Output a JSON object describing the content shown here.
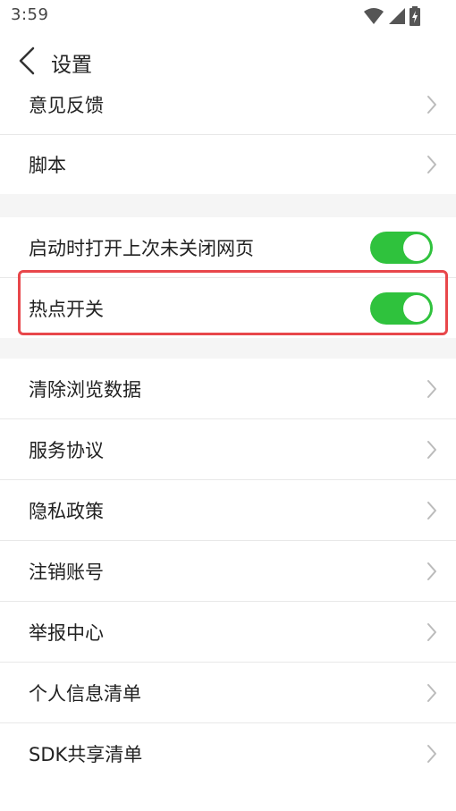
{
  "status_bar": {
    "time": "3:59",
    "icons": [
      "wifi-icon",
      "cellular-signal-icon",
      "battery-charging-icon"
    ]
  },
  "header": {
    "back_icon": "chevron-left-icon",
    "title": "设置"
  },
  "settings": {
    "group1": [
      {
        "label": "意见反馈"
      },
      {
        "label": "脚本"
      }
    ],
    "group2": [
      {
        "label": "启动时打开上次未关闭网页",
        "toggle": true
      },
      {
        "label": "热点开关",
        "toggle": true
      }
    ],
    "group3": [
      {
        "label": "清除浏览数据"
      },
      {
        "label": "服务协议"
      },
      {
        "label": "隐私政策"
      },
      {
        "label": "注销账号"
      },
      {
        "label": "举报中心"
      },
      {
        "label": "个人信息清单"
      },
      {
        "label": "SDK共享清单"
      }
    ]
  },
  "colors": {
    "toggle_on": "#2fc23d",
    "highlight_border": "#e8474b",
    "section_gap": "#f5f5f5",
    "divider": "#e8e8e8",
    "chevron": "#bbbbbb"
  }
}
